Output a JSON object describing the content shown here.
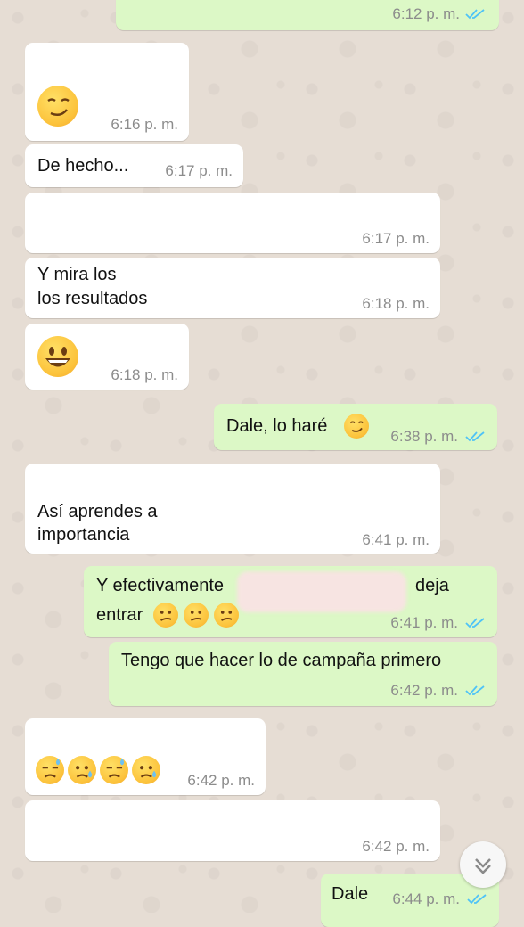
{
  "messages": [
    {
      "time": "6:12 p. m."
    },
    {
      "time": "6:16 p. m.",
      "emoji": "smirk-emoji"
    },
    {
      "text": "De hecho...",
      "time": "6:17 p. m."
    },
    {
      "time": "6:17 p. m."
    },
    {
      "line1": "Y mira los",
      "line2": "los resultados",
      "time": "6:18 p. m."
    },
    {
      "time": "6:18 p. m.",
      "emoji": "grinning-emoji"
    },
    {
      "text": "Dale, lo haré",
      "time": "6:38 p. m.",
      "emoji": "smirk-emoji"
    },
    {
      "line1": "Así aprendes a",
      "line2": "importancia",
      "time": "6:41 p. m."
    },
    {
      "line1a": "Y efectivamente",
      "line1b": "deja",
      "line2": "entrar",
      "time": "6:41 p. m.",
      "emoji": "confused-emoji x3"
    },
    {
      "text": "Tengo que hacer lo de campaña primero",
      "time": "6:42 p. m."
    },
    {
      "time": "6:42 p. m.",
      "emoji": "sad-sweat-emoji x4"
    },
    {
      "time": "6:42 p. m."
    },
    {
      "text": "Dale",
      "time": "6:44 p. m."
    }
  ],
  "colors": {
    "incoming_bubble": "#ffffff",
    "outgoing_bubble": "#dcf8c6",
    "read_ticks": "#4fc3f7",
    "background": "#e6ddd4"
  },
  "icons": {
    "scroll_down": "double-chevron-down-icon",
    "read_receipt": "double-check-icon"
  }
}
